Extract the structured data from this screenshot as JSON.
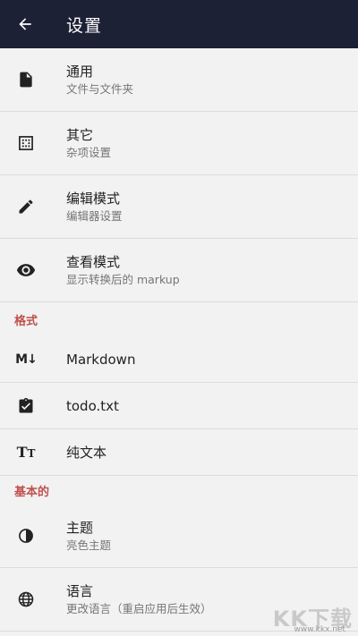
{
  "appbar": {
    "title": "设置",
    "back_icon": "arrow-left-icon",
    "background": "#1d2136"
  },
  "general": [
    {
      "icon": "file-icon",
      "title": "通用",
      "subtitle": "文件与文件夹"
    },
    {
      "icon": "grid-dots-icon",
      "title": "其它",
      "subtitle": "杂项设置"
    },
    {
      "icon": "pencil-icon",
      "title": "编辑模式",
      "subtitle": "编辑器设置"
    },
    {
      "icon": "eye-icon",
      "title": "查看模式",
      "subtitle": "显示转换后的 markup"
    }
  ],
  "formats": {
    "header": "格式",
    "items": [
      {
        "icon": "markdown-icon",
        "icon_text": "M↓",
        "title": "Markdown"
      },
      {
        "icon": "clipboard-check-icon",
        "title": "todo.txt"
      },
      {
        "icon": "text-format-icon",
        "icon_big": "T",
        "icon_small": "T",
        "title": "纯文本"
      }
    ]
  },
  "basic": {
    "header": "基本的",
    "items": [
      {
        "icon": "contrast-icon",
        "title": "主题",
        "subtitle": "亮色主题"
      },
      {
        "icon": "globe-icon",
        "title": "语言",
        "subtitle": "更改语言（重启应用后生效）"
      }
    ]
  },
  "watermark": {
    "main": "KK下载",
    "url": "www.kkx.net"
  },
  "colors": {
    "section_header": "#c0504d",
    "background": "#f2f2f2",
    "divider": "#dcdcdc"
  }
}
